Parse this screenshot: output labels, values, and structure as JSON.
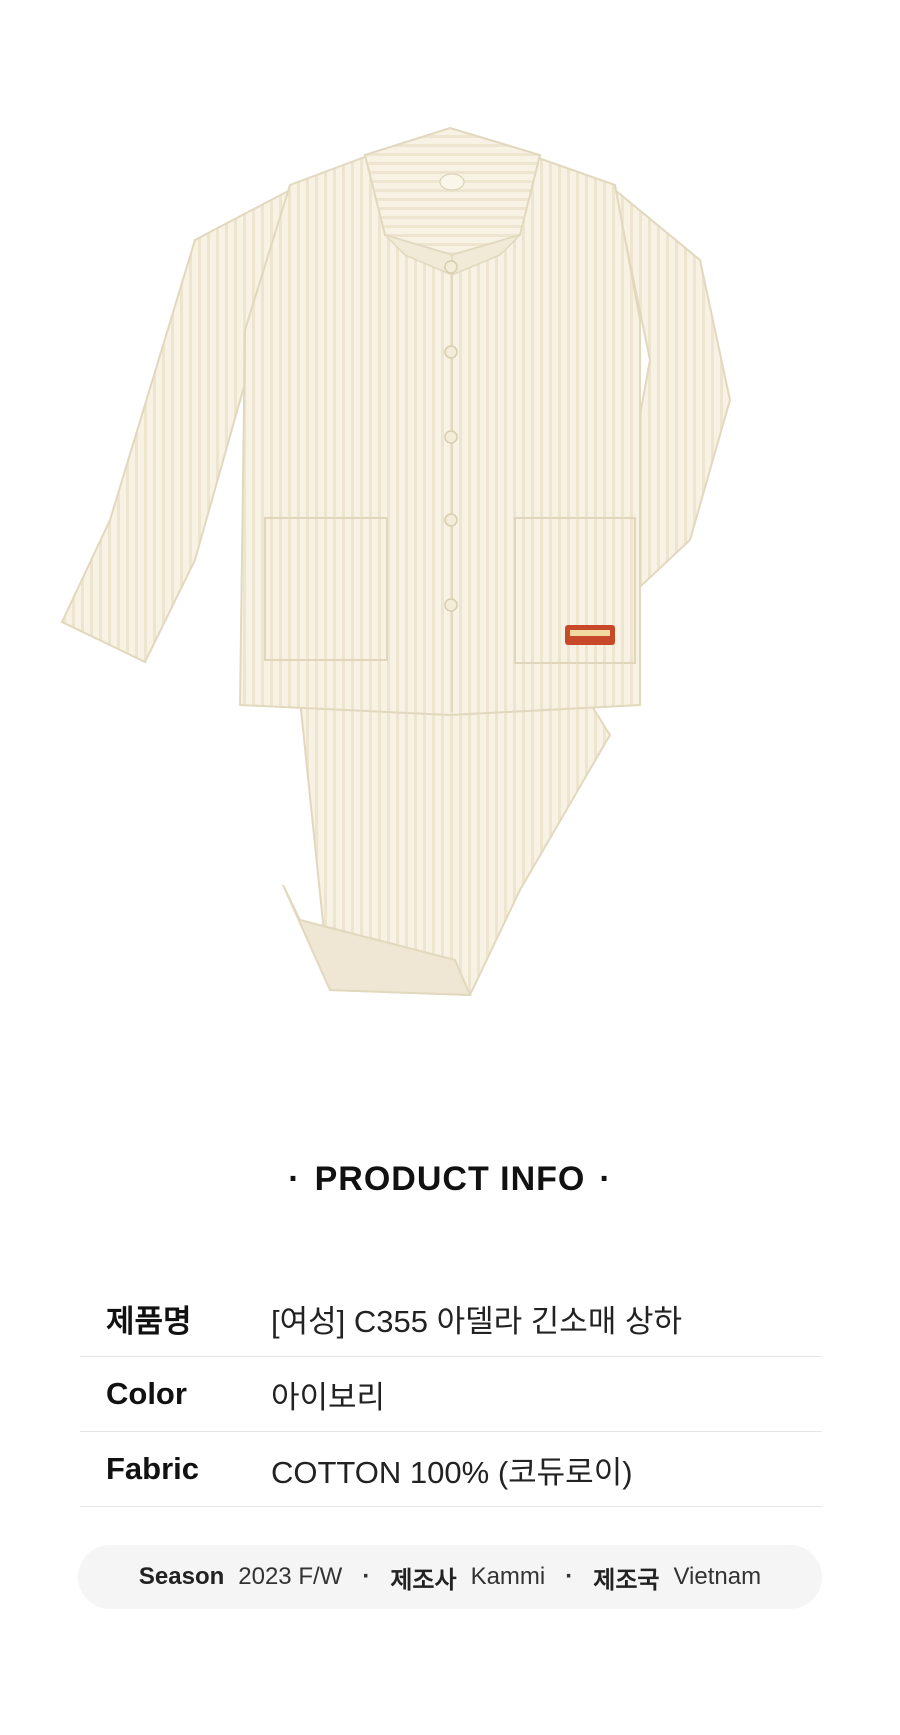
{
  "product_image": {
    "alt": "ivory corduroy pajama set"
  },
  "section": {
    "title": "PRODUCT INFO",
    "dot": "·"
  },
  "info": [
    {
      "label": "제품명",
      "value": "[여성] C355 아델라 긴소매 상하"
    },
    {
      "label": "Color",
      "value": "아이보리"
    },
    {
      "label": "Fabric",
      "value": "COTTON 100% (코듀로이)"
    }
  ],
  "meta": {
    "season_label": "Season",
    "season_value": "2023 F/W",
    "maker_label": "제조사",
    "maker_value": "Kammi",
    "country_label": "제조국",
    "country_value": "Vietnam",
    "separator": "·"
  },
  "colors": {
    "garment": "#f6f1e2",
    "garment_shadow": "#e7dfc8",
    "patch": "#c8482a"
  }
}
